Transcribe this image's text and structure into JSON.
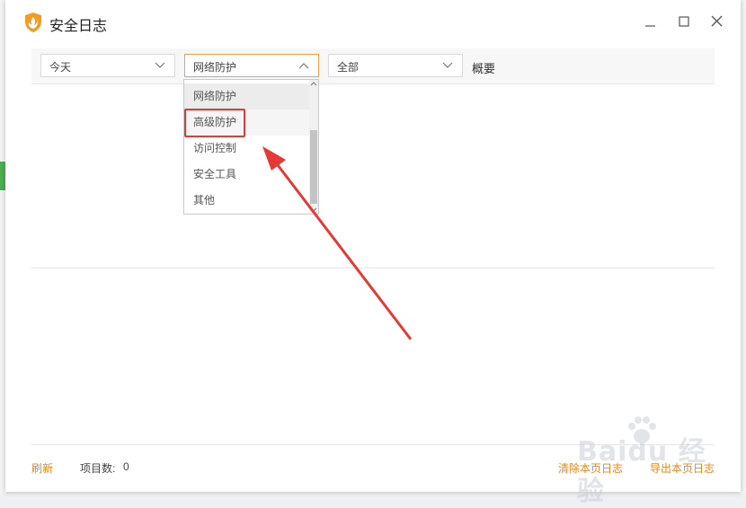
{
  "window": {
    "title": "安全日志"
  },
  "filters": {
    "time_value": "今天",
    "category_value": "网络防护",
    "type_value": "全部",
    "summary_label": "概要"
  },
  "dropdown": {
    "items": [
      "网络防护",
      "高级防护",
      "访问控制",
      "安全工具",
      "其他"
    ],
    "selected_index": 0,
    "highlighted_index": 1
  },
  "footer": {
    "refresh_label": "刷新",
    "count_label": "项目数:",
    "count_value": "0",
    "clear_label": "清除本页日志",
    "export_label": "导出本页日志"
  },
  "annotation": {
    "color": "#e53935"
  },
  "colors": {
    "accent": "#e8861e",
    "highlight": "#e53935"
  },
  "watermark": {
    "text": "Baidu 经验"
  }
}
